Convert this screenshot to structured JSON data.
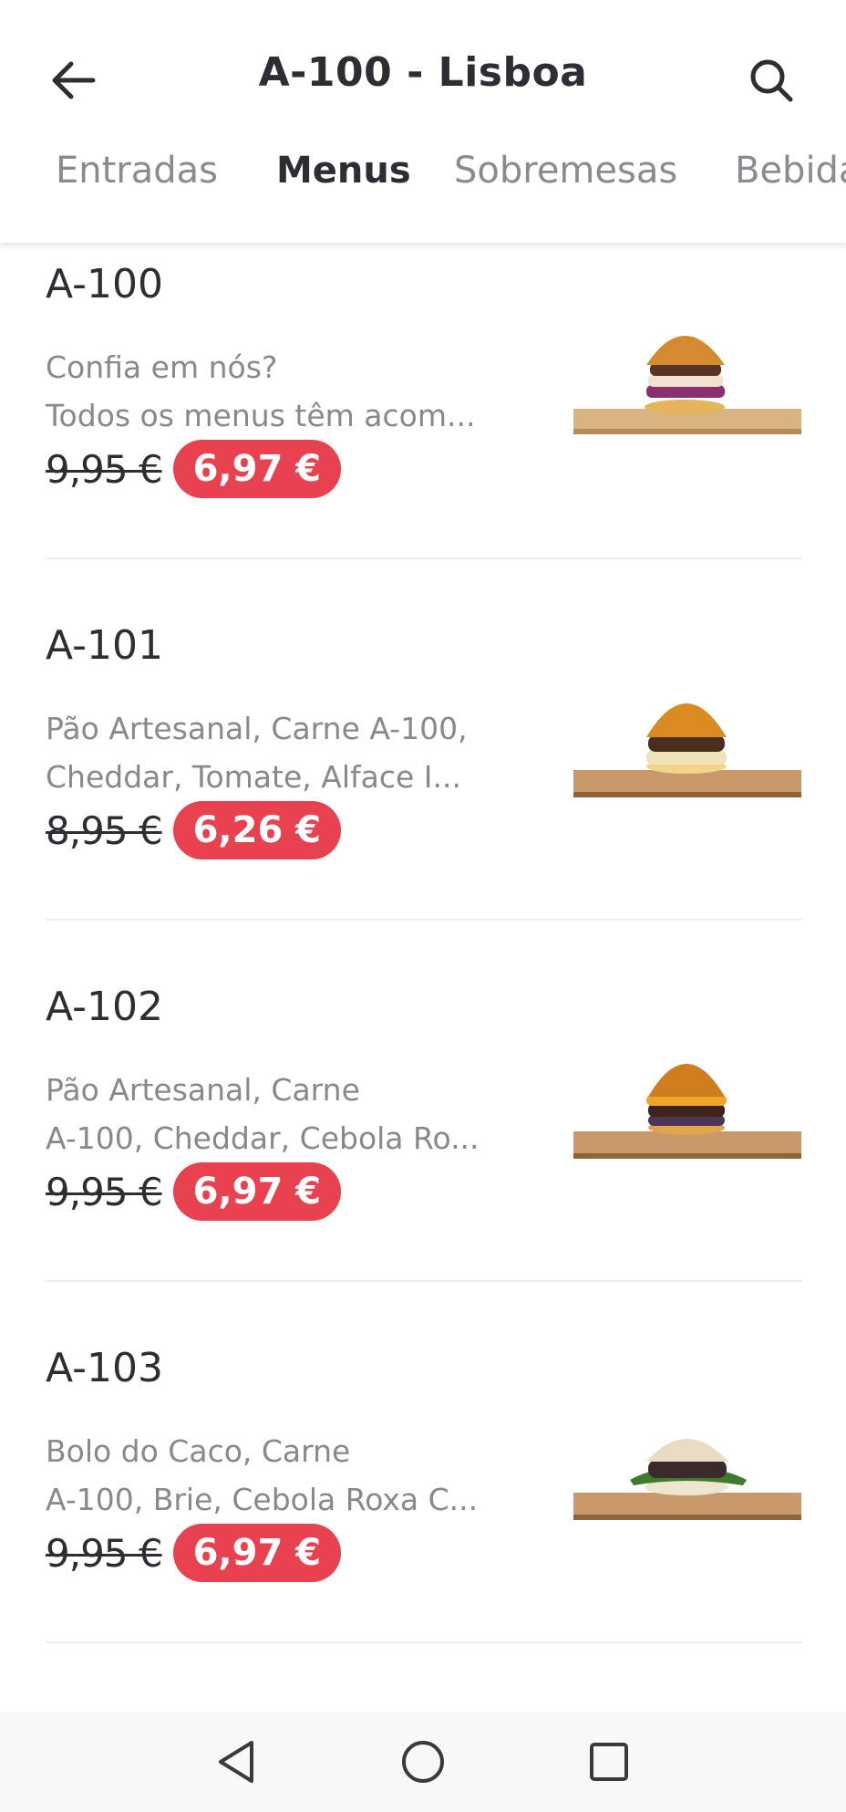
{
  "header": {
    "title": "A-100 - Lisboa",
    "back_icon": "arrow-left-icon",
    "search_icon": "search-icon"
  },
  "tabs": [
    {
      "label": "Entradas",
      "active": false
    },
    {
      "label": "Menus",
      "active": true
    },
    {
      "label": "Sobremesas",
      "active": false
    },
    {
      "label": "Bebidas",
      "active": false
    }
  ],
  "items": [
    {
      "name": "A-100",
      "desc_line1": "Confia em nós?",
      "desc_line2": "Todos os menus têm acom...",
      "old_price": "9,95 €",
      "new_price": "6,97 €",
      "image_icon": "burger-image"
    },
    {
      "name": "A-101",
      "desc_line1": "Pão Artesanal, Carne A-100,",
      "desc_line2": "Cheddar, Tomate, Alface I...",
      "old_price": "8,95 €",
      "new_price": "6,26 €",
      "image_icon": "burger-image"
    },
    {
      "name": "A-102",
      "desc_line1": "Pão Artesanal, Carne",
      "desc_line2": "A-100, Cheddar, Cebola Ro...",
      "old_price": "9,95 €",
      "new_price": "6,97 €",
      "image_icon": "burger-image"
    },
    {
      "name": "A-103",
      "desc_line1": "Bolo do Caco, Carne",
      "desc_line2": "A-100, Brie, Cebola Roxa C...",
      "old_price": "9,95 €",
      "new_price": "6,97 €",
      "image_icon": "burger-image"
    }
  ],
  "navbar": {
    "back_icon": "triangle-back-icon",
    "home_icon": "circle-home-icon",
    "recents_icon": "square-recents-icon"
  },
  "colors": {
    "accent": "#e8414f",
    "text_primary": "#2d2d33",
    "text_secondary": "#88888e"
  }
}
